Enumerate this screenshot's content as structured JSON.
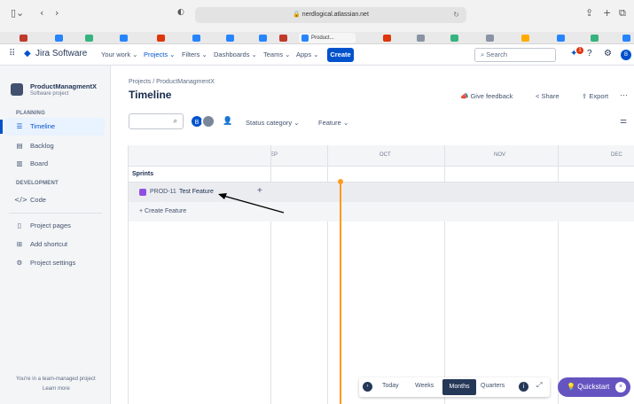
{
  "browser": {
    "url": "nerdlogical.atlassian.net",
    "active_tab_label": "Product..."
  },
  "nav": {
    "logo_text": "Jira Software",
    "your_work": "Your work",
    "projects": "Projects",
    "filters": "Filters",
    "dashboards": "Dashboards",
    "teams": "Teams",
    "apps": "Apps",
    "create": "Create",
    "search_placeholder": "Search",
    "notification_count": "1"
  },
  "sidebar": {
    "project_name": "ProductManagmentX",
    "project_type": "Software project",
    "planning_heading": "PLANNING",
    "development_heading": "DEVELOPMENT",
    "items": {
      "timeline": "Timeline",
      "backlog": "Backlog",
      "board": "Board",
      "code": "Code",
      "project_pages": "Project pages",
      "add_shortcut": "Add shortcut",
      "project_settings": "Project settings"
    },
    "footer_text": "You're in a team-managed project",
    "learn_more": "Learn more"
  },
  "main": {
    "breadcrumb_projects": "Projects",
    "breadcrumb_sep": "/",
    "breadcrumb_project": "ProductManagmentX",
    "title": "Timeline",
    "give_feedback": "Give feedback",
    "share": "Share",
    "export": "Export",
    "avatar_initial": "B",
    "filter_status": "Status category",
    "filter_feature": "Feature"
  },
  "timeline": {
    "months": [
      "EP",
      "OCT",
      "NOV",
      "DEC"
    ],
    "sprints_label": "Sprints",
    "issue_key": "PROD-11",
    "issue_title": "Test Feature",
    "create_feature": "+ Create Feature"
  },
  "toolbar": {
    "today": "Today",
    "weeks": "Weeks",
    "months": "Months",
    "quarters": "Quarters"
  },
  "quickstart": {
    "label": "Quickstart"
  },
  "colors": {
    "accent": "#0052cc",
    "quickstart": "#6554c0",
    "today_line": "#ff991f",
    "issue_icon": "#904ee2"
  }
}
